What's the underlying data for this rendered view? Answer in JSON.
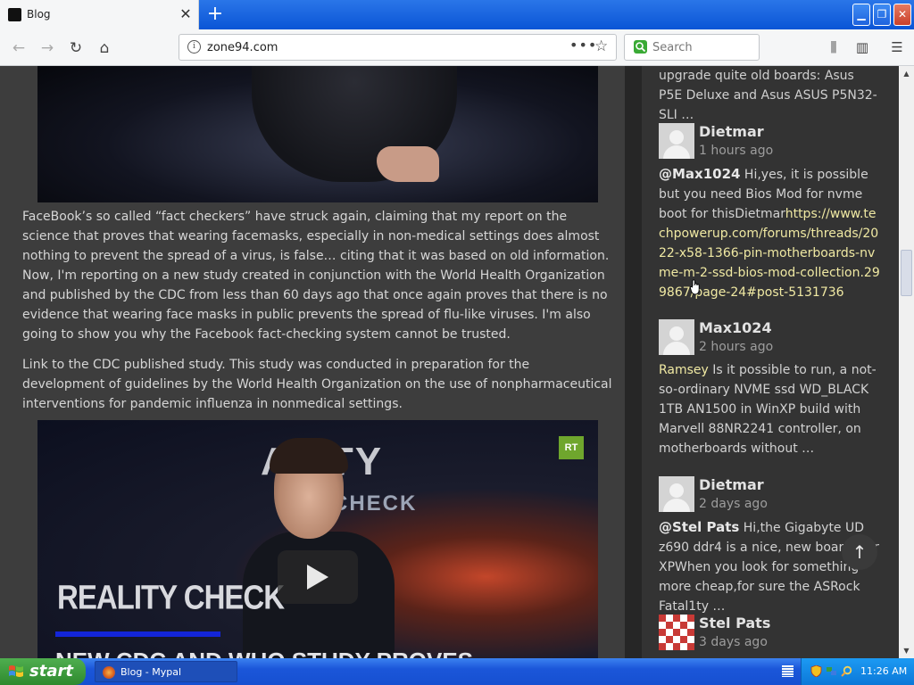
{
  "browser": {
    "tab_title": "Blog",
    "url": "zone94.com",
    "search_placeholder": "Search"
  },
  "article": {
    "para1": "FaceBook’s so called “fact checkers” have struck again, claiming that my report on the science that proves that wearing facemasks, especially in non-medical settings does almost nothing to prevent the spread of a virus, is false… citing that it was based on old information. Now, I'm reporting on a new study created in conjunction with the World Health Organization and published by the CDC from less than 60 days ago that once again proves that there is no evidence that wearing face masks in public prevents the spread of flu-like viruses. I'm also going to show you why the Facebook fact-checking system cannot be trusted.",
    "para2": "Link to the CDC published study. This study was conducted in preparation for the development of guidelines by the World Health Organization on the use of nonpharmaceutical interventions for pandemic influenza in nonmedical settings.",
    "video2": {
      "logo_top": "ALITY",
      "logo_bottom": "CHECK",
      "rt_badge": "RT",
      "title": "REALITY CHECK",
      "subtitle": "NEW CDC AND WHO STUDY PROVES"
    }
  },
  "sidebar": {
    "first_fragment": "upgrade quite old boards: Asus P5E Deluxe and Asus ASUS P5N32-SLI …",
    "comments": [
      {
        "author": "Dietmar",
        "time": "1 hours ago",
        "mention": "@Max1024",
        "text": " Hi,yes, it is possible but you need Bios Mod for nvme boot for thisDietmar",
        "link": "https://www.techpowerup.com/forums/threads/2022-x58-1366-pin-motherboards-nvme-m-2-ssd-bios-mod-collection.299867/page-24#post-5131736"
      },
      {
        "author": "Max1024",
        "time": "2 hours ago",
        "mention": "Ramsey",
        "text": " Is it possible to run, a not-so-ordinary NVME ssd WD_BLACK 1TB AN1500 in WinXP build with  Marvell 88NR2241 controller, on motherboards without …"
      },
      {
        "author": "Dietmar",
        "time": "2 days ago",
        "mention": "@Stel Pats",
        "text": " Hi,the Gigabyte UD z690 ddr4 is a nice, new boards for XPWhen you look for something more cheap,for sure the ASRock Fatal1ty …"
      },
      {
        "author": "Stel Pats",
        "time": "3 days ago"
      }
    ]
  },
  "taskbar": {
    "start_label": "start",
    "task_label": "Blog - Mypal",
    "clock": "11:26 AM"
  },
  "colors": {
    "link": "#f0e9a3",
    "taskbar": "#1650d1",
    "start": "#2e8a2e"
  }
}
